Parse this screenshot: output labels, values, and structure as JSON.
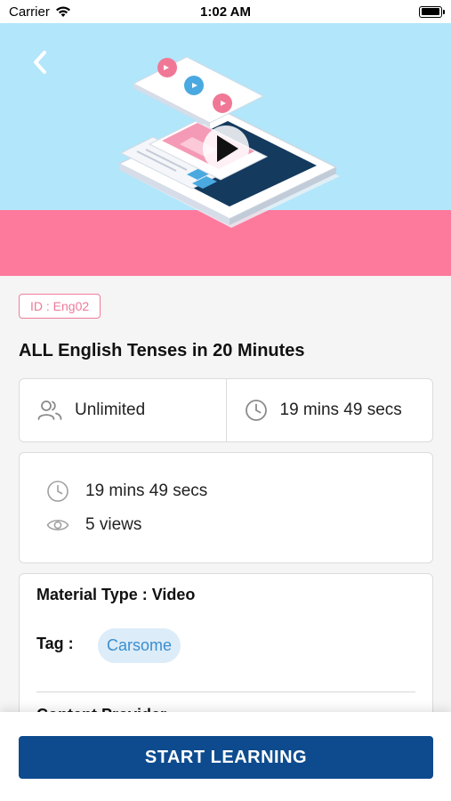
{
  "status_bar": {
    "carrier": "Carrier",
    "time": "1:02 AM",
    "icons": [
      "wifi-icon",
      "battery-icon"
    ]
  },
  "hero": {
    "back_icon": "chevron-left-icon",
    "illustration": "tablet-video-play-illustration",
    "colors": {
      "sky": "#b1e6fb",
      "ground": "#fd7a9d"
    }
  },
  "course": {
    "id_label": "ID : Eng02",
    "title": "ALL English Tenses in 20 Minutes"
  },
  "stats": {
    "participants": {
      "icon": "users-icon",
      "value": "Unlimited"
    },
    "duration": {
      "icon": "clock-icon",
      "value": "19 mins 49 secs"
    }
  },
  "info": {
    "duration": {
      "icon": "clock-icon",
      "value": "19 mins 49 secs"
    },
    "views": {
      "icon": "eye-icon",
      "value": "5 views"
    }
  },
  "details": {
    "material_type_label": "Material Type :",
    "material_type_value": "Video",
    "tag_label": "Tag :",
    "tag_value": "Carsome",
    "content_provider_label": "Content Provider"
  },
  "actions": {
    "start_label": "START LEARNING",
    "accent_color": "#0d4b8e"
  }
}
